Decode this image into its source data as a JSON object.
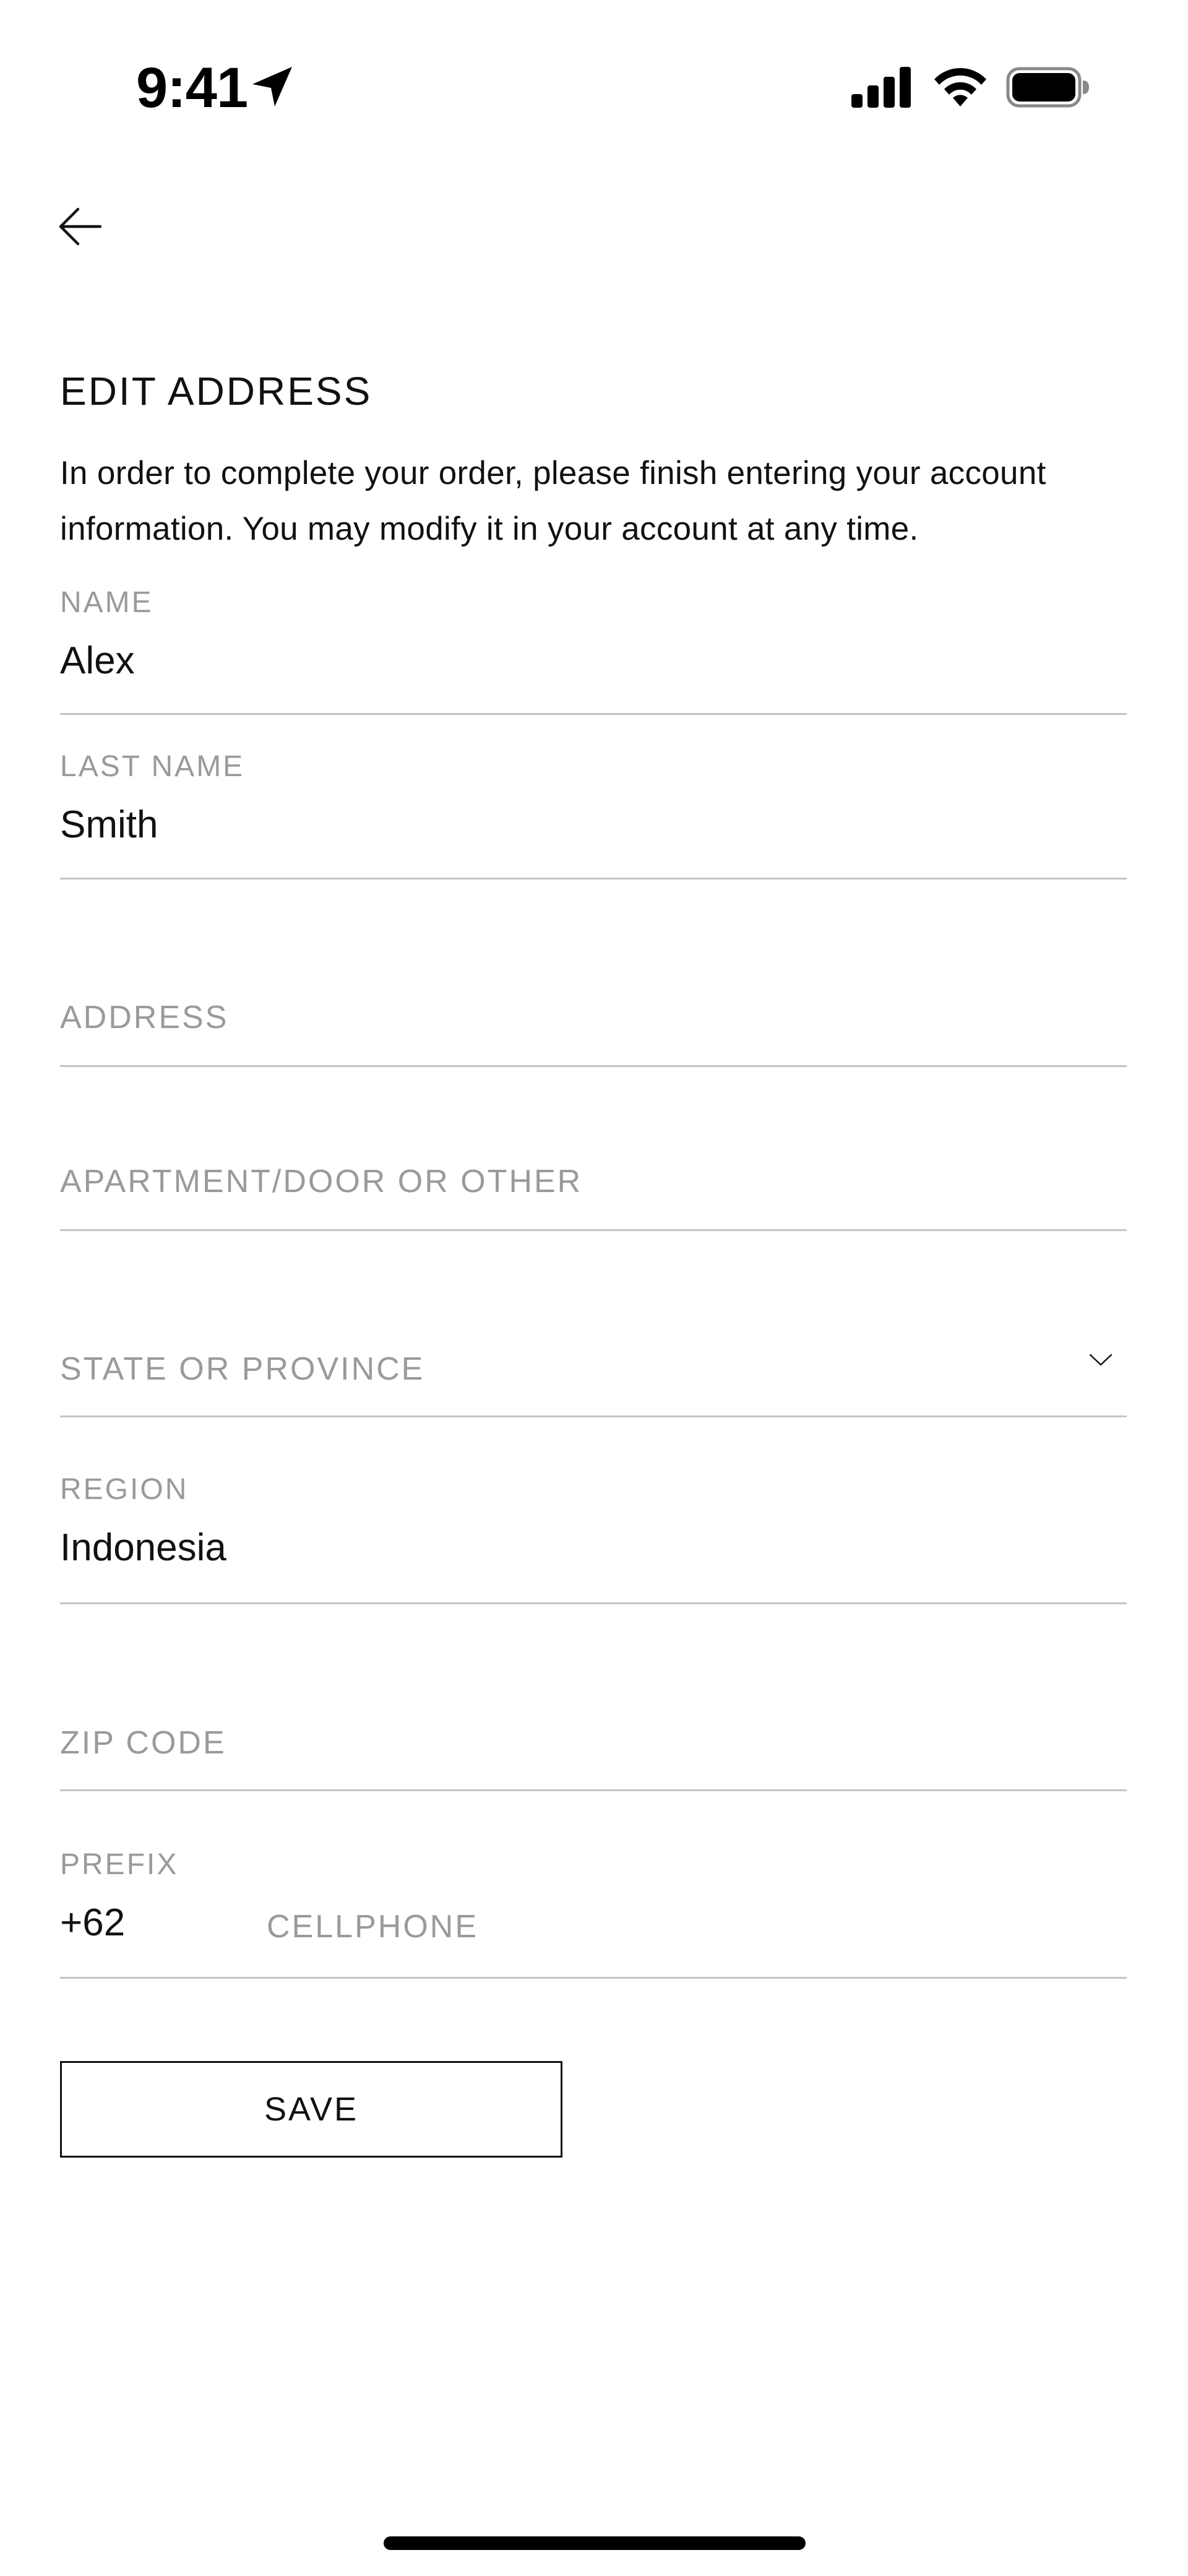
{
  "status_bar": {
    "time": "9:41",
    "icons": [
      "location-arrow-icon",
      "cellular-signal-icon",
      "wifi-icon",
      "battery-icon"
    ]
  },
  "header": {
    "back_icon": "arrow-left-icon",
    "title": "EDIT ADDRESS",
    "intro": "In order to complete your order, please finish entering your account information. You may modify it in your account at any time."
  },
  "form": {
    "name": {
      "label": "NAME",
      "value": "Alex"
    },
    "last_name": {
      "label": "LAST NAME",
      "value": "Smith"
    },
    "address": {
      "placeholder": "ADDRESS"
    },
    "apartment": {
      "placeholder": "APARTMENT/DOOR OR OTHER"
    },
    "state": {
      "placeholder": "STATE OR PROVINCE",
      "icon": "chevron-down-icon"
    },
    "region": {
      "label": "REGION",
      "value": "Indonesia"
    },
    "zip": {
      "placeholder": "ZIP CODE"
    },
    "phone": {
      "prefix_label": "PREFIX",
      "prefix_value": "+62",
      "placeholder": "CELLPHONE"
    }
  },
  "actions": {
    "save_label": "SAVE"
  },
  "colors": {
    "text": "#111111",
    "muted": "#9a9a9a",
    "divider": "#c4c4c4",
    "background": "#ffffff"
  }
}
